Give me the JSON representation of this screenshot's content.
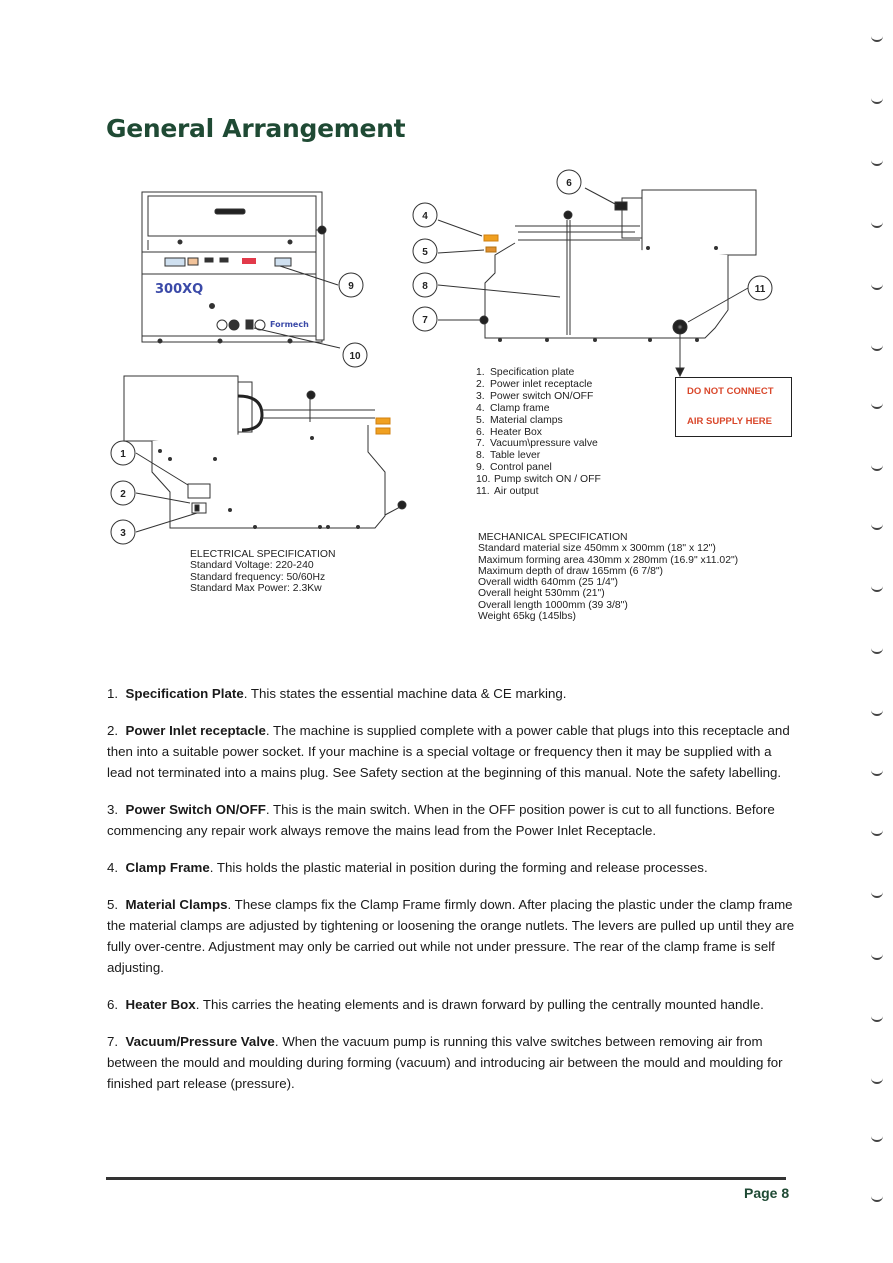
{
  "page": {
    "title": "General Arrangement",
    "page_number": "Page 8"
  },
  "diagram": {
    "callouts": [
      "1",
      "2",
      "3",
      "4",
      "5",
      "6",
      "7",
      "8",
      "9",
      "10",
      "11"
    ],
    "front_view": {
      "model_label": "300XQ",
      "brand_label": "Formech"
    },
    "legend": [
      {
        "num": "1.",
        "label": "Specification plate"
      },
      {
        "num": "2.",
        "label": "Power inlet receptacle"
      },
      {
        "num": "3.",
        "label": "Power switch ON/OFF"
      },
      {
        "num": "4.",
        "label": "Clamp frame"
      },
      {
        "num": "5.",
        "label": "Material clamps"
      },
      {
        "num": "6.",
        "label": "Heater Box"
      },
      {
        "num": "7.",
        "label": "Vacuum\\pressure valve"
      },
      {
        "num": "8.",
        "label": "Table lever"
      },
      {
        "num": "9.",
        "label": "Control panel"
      },
      {
        "num": "10.",
        "label": "Pump switch ON / OFF"
      },
      {
        "num": "11.",
        "label": "Air output"
      }
    ],
    "warning": {
      "line1": "DO NOT CONNECT",
      "line2": "AIR SUPPLY HERE",
      "color": "#d9472b"
    }
  },
  "electrical_spec": {
    "heading": "ELECTRICAL SPECIFICATION",
    "lines": [
      "Standard Voltage: 220-240",
      "Standard frequency: 50/60Hz",
      "Standard Max Power: 2.3Kw"
    ]
  },
  "mechanical_spec": {
    "heading": "MECHANICAL SPECIFICATION",
    "lines": [
      "Standard material size 450mm x 300mm (18\" x 12\")",
      "Maximum forming area 430mm  x  280mm  (16.9\" x11.02\")",
      "Maximum depth of draw 165mm  (6 7/8\")",
      "Overall width 640mm (25 1/4\")",
      "Overall height 530mm (21\")",
      "Overall length 1000mm (39 3/8\")",
      "Weight 65kg  (145lbs)"
    ]
  },
  "sections": [
    {
      "num": "1.",
      "title": "Specification Plate",
      "text": ". This states the essential machine data & CE marking."
    },
    {
      "num": "2.",
      "title": "Power Inlet receptacle",
      "text": ". The machine is supplied complete with a power cable that plugs into this receptacle and then into a suitable power socket.  If your machine is a special voltage or frequency then it may be supplied with a lead not terminated into a mains plug. See Safety section at the beginning of this manual. Note the safety labelling."
    },
    {
      "num": "3.",
      "title": "Power Switch ON/OFF",
      "text": ". This is the main switch. When in the OFF position power is cut to all functions. Before commencing any repair work always remove the mains lead from the Power Inlet Receptacle."
    },
    {
      "num": "4.",
      "title": "Clamp Frame",
      "text": ". This holds the plastic material in position during the forming and release processes."
    },
    {
      "num": "5.",
      "title": "Material Clamps",
      "text": ". These clamps fix the Clamp Frame firmly down.  After placing the plastic under the clamp frame the material clamps are adjusted by tightening or loosening the orange nutlets.  The levers are pulled up until they are fully over-centre.  Adjustment may only be carried out while not under pressure.  The rear of the clamp frame is self adjusting."
    },
    {
      "num": "6.",
      "title": "Heater Box",
      "text": ".  This carries the heating elements and is drawn forward by pulling the centrally mounted handle."
    },
    {
      "num": "7.",
      "title": "Vacuum/Pressure Valve",
      "text": ".  When the vacuum pump is running this valve switches between removing air from between the mould and moulding during forming (vacuum) and introducing air between the mould and moulding for finished part release (pressure)."
    }
  ],
  "colors": {
    "title": "#1f4a34",
    "warning": "#d9472b",
    "orange_parts": "#f0a020"
  }
}
